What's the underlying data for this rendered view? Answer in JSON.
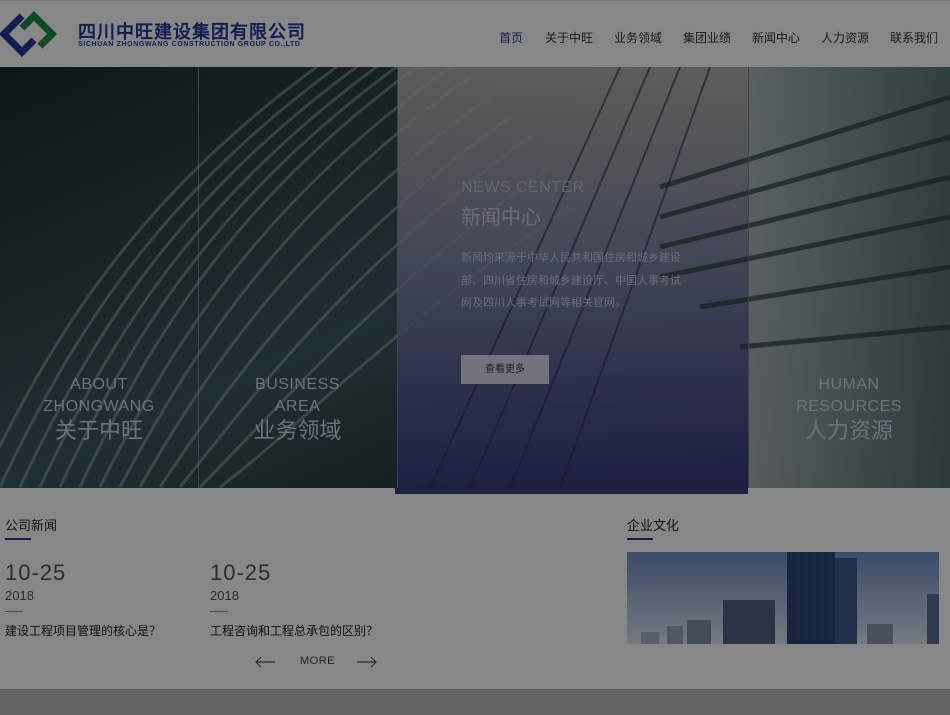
{
  "brand": {
    "name_cn": "四川中旺建设集团有限公司",
    "name_en": "SICHUAN ZHONGWANG CONSTRUCTION GROUP CO.,LTD"
  },
  "nav": {
    "items": [
      {
        "label": "首页",
        "active": true
      },
      {
        "label": "关于中旺"
      },
      {
        "label": "业务领域"
      },
      {
        "label": "集团业绩"
      },
      {
        "label": "新闻中心"
      },
      {
        "label": "人力资源"
      },
      {
        "label": "联系我们"
      }
    ]
  },
  "hero": {
    "panels": {
      "about": {
        "en1": "ABOUT",
        "en2": "ZHONGWANG",
        "cn": "关于中旺"
      },
      "business": {
        "en1": "BUSINESS",
        "en2": "AREA",
        "cn": "业务领域"
      },
      "news": {
        "en": "NEWS CENTER",
        "cn": "新闻中心",
        "desc": "新闻均来源于中华人民共和国住房和城乡建设部、四川省住房和城乡建设厅、中国人事考试网及四川人事考试网等相关官网。",
        "button": "查看更多"
      },
      "hr": {
        "en1": "HUMAN",
        "en2": "RESOURCES",
        "cn": "人力资源"
      }
    }
  },
  "company_news": {
    "title": "公司新闻",
    "items": [
      {
        "date": "10-25",
        "year": "2018",
        "title": "建设工程项目管理的核心是？"
      },
      {
        "date": "10-25",
        "year": "2018",
        "title": "工程咨询和工程总承包的区别？"
      }
    ],
    "more": "MORE"
  },
  "culture": {
    "title": "企业文化"
  },
  "colors": {
    "brand": "#26389a",
    "brand_green": "#1f8a4c",
    "active_bar": "#3e3f73"
  },
  "icons": {
    "logo": "interlocked-chain-logo",
    "prev": "arrow-left-icon",
    "next": "arrow-right-icon"
  }
}
